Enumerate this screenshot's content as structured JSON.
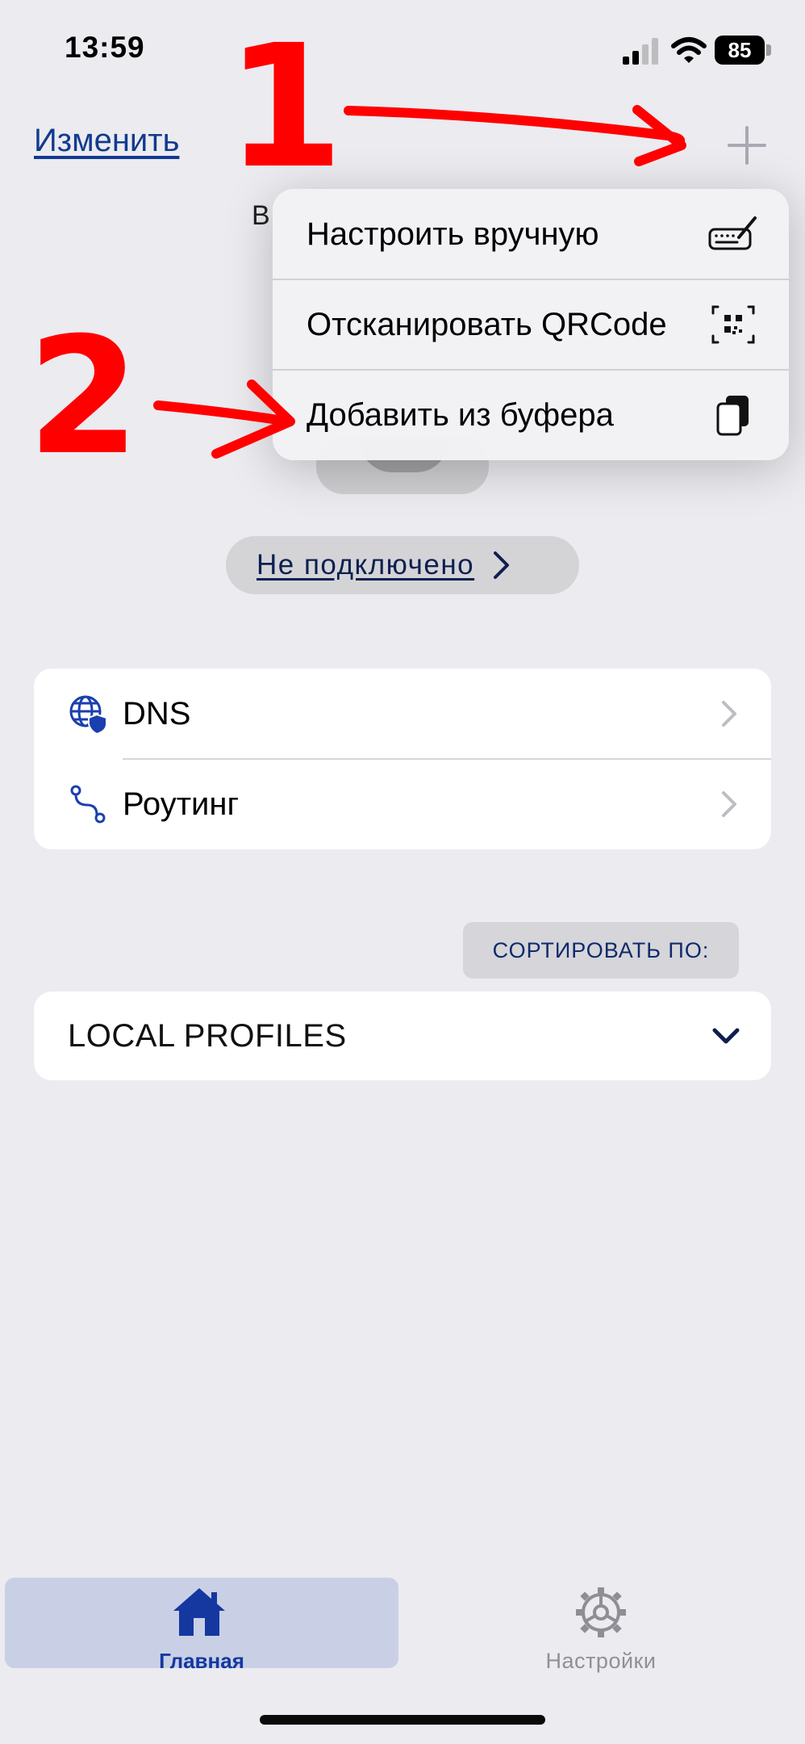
{
  "status_bar": {
    "time": "13:59",
    "battery": "85"
  },
  "nav": {
    "edit_label": "Изменить"
  },
  "background": {
    "partial_letter": "В"
  },
  "connection": {
    "status": "Не подключено"
  },
  "settings": {
    "items": [
      {
        "label": "DNS",
        "icon": "globe-shield-icon"
      },
      {
        "label": "Роутинг",
        "icon": "route-icon"
      }
    ]
  },
  "sort": {
    "label": "СОРТИРОВАТЬ ПО:"
  },
  "profiles": {
    "section_label": "LOCAL PROFILES"
  },
  "add_menu": {
    "items": [
      {
        "label": "Настроить вручную",
        "icon": "keyboard-pen-icon"
      },
      {
        "label": "Отсканировать QRCode",
        "icon": "qr-scan-icon"
      },
      {
        "label": "Добавить из буфера",
        "icon": "clipboard-icon"
      }
    ]
  },
  "annotations": {
    "marker_1": "1",
    "marker_2": "2",
    "color": "#FF0000"
  },
  "tabs": {
    "home": {
      "label": "Главная",
      "active": true
    },
    "settings": {
      "label": "Настройки",
      "active": false
    }
  },
  "colors": {
    "accent": "#123A8F",
    "background": "#EBEBF0",
    "annotation": "#FF0000"
  }
}
